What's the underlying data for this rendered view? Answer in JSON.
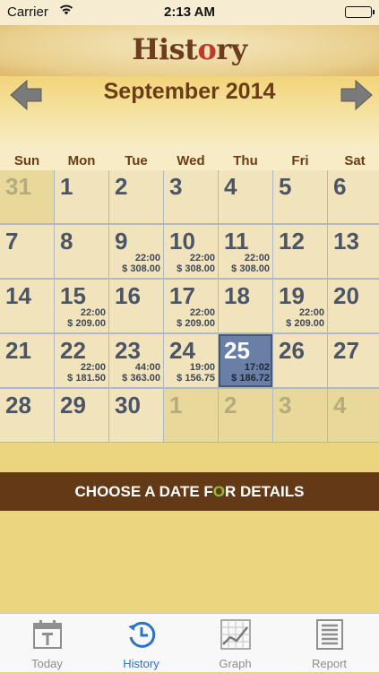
{
  "status_bar": {
    "carrier": "Carrier",
    "time": "2:13 AM"
  },
  "header": {
    "logo_text_pre": "Hist",
    "logo_text_check": "o",
    "logo_text_post": "ry"
  },
  "calendar": {
    "month": "September 2014",
    "weekdays": [
      "Sun",
      "Mon",
      "Tue",
      "Wed",
      "Thu",
      "Fri",
      "Sat"
    ],
    "weeks": [
      [
        {
          "day": "31",
          "other": true
        },
        {
          "day": "1"
        },
        {
          "day": "2"
        },
        {
          "day": "3"
        },
        {
          "day": "4"
        },
        {
          "day": "5"
        },
        {
          "day": "6"
        }
      ],
      [
        {
          "day": "7"
        },
        {
          "day": "8"
        },
        {
          "day": "9",
          "hours": "22:00",
          "amount": "$ 308.00"
        },
        {
          "day": "10",
          "hours": "22:00",
          "amount": "$ 308.00"
        },
        {
          "day": "11",
          "hours": "22:00",
          "amount": "$ 308.00"
        },
        {
          "day": "12"
        },
        {
          "day": "13"
        }
      ],
      [
        {
          "day": "14"
        },
        {
          "day": "15",
          "hours": "22:00",
          "amount": "$ 209.00"
        },
        {
          "day": "16"
        },
        {
          "day": "17",
          "hours": "22:00",
          "amount": "$ 209.00"
        },
        {
          "day": "18"
        },
        {
          "day": "19",
          "hours": "22:00",
          "amount": "$ 209.00"
        },
        {
          "day": "20"
        }
      ],
      [
        {
          "day": "21"
        },
        {
          "day": "22",
          "hours": "22:00",
          "amount": "$ 181.50"
        },
        {
          "day": "23",
          "hours": "44:00",
          "amount": "$ 363.00"
        },
        {
          "day": "24",
          "hours": "19:00",
          "amount": "$ 156.75"
        },
        {
          "day": "25",
          "hours": "17:02",
          "amount": "$ 186.72",
          "selected": true
        },
        {
          "day": "26"
        },
        {
          "day": "27"
        }
      ],
      [
        {
          "day": "28"
        },
        {
          "day": "29"
        },
        {
          "day": "30"
        },
        {
          "day": "1",
          "other": true
        },
        {
          "day": "2",
          "other": true
        },
        {
          "day": "3",
          "other": true
        },
        {
          "day": "4",
          "other": true
        }
      ]
    ]
  },
  "banner": {
    "text_pre": "CHOOSE A DATE F",
    "text_o": "O",
    "text_post": "R DETAILS"
  },
  "tabs": [
    {
      "label": "Today",
      "icon": "calendar-icon"
    },
    {
      "label": "History",
      "icon": "history-clock-icon",
      "active": true
    },
    {
      "label": "Graph",
      "icon": "graph-icon"
    },
    {
      "label": "Report",
      "icon": "report-icon"
    }
  ],
  "colors": {
    "accent": "#2a73c9",
    "brand_brown": "#633916",
    "selected_day": "#6a7fa6"
  }
}
